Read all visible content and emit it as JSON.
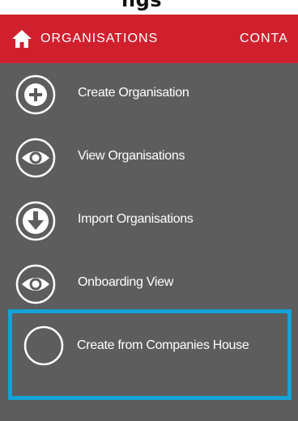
{
  "page": {
    "heading_fragment": "ngs"
  },
  "navbar": {
    "home_icon": "home-icon",
    "tabs": [
      {
        "label": "ORGANISATIONS"
      },
      {
        "label": "CONTA"
      }
    ],
    "color": "#d0202e"
  },
  "menu": {
    "background": "#5d5d5d",
    "highlight_color": "#13a3d6",
    "items": [
      {
        "label": "Create Organisation",
        "icon": "plus-circle-icon"
      },
      {
        "label": "View Organisations",
        "icon": "eye-circle-icon"
      },
      {
        "label": "Import Organisations",
        "icon": "arrow-down-circle-icon"
      },
      {
        "label": "Onboarding View",
        "icon": "eye-circle-icon"
      },
      {
        "label": "Create from Companies House",
        "icon": "empty-circle-icon",
        "highlighted": true
      }
    ]
  }
}
